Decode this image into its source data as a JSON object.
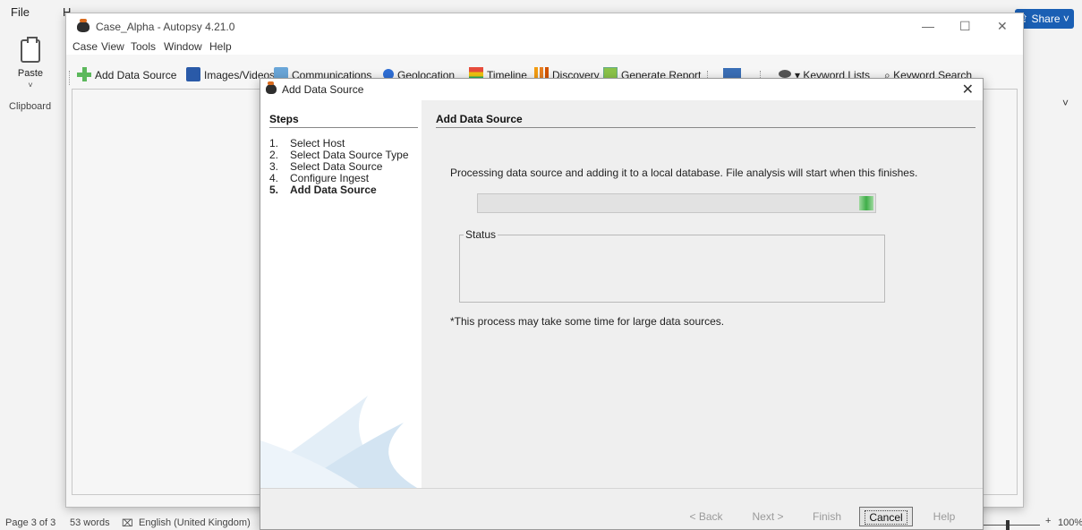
{
  "word": {
    "file_tab": "File",
    "second_tab": "H",
    "paste_label": "Paste",
    "clipboard_label": "Clipboard",
    "share_label": "⇪ Share ˅",
    "status": {
      "page": "Page 3 of 3",
      "words": "53 words",
      "language": "English (United Kingdom)",
      "zoom_plus": "+",
      "zoom": "100%"
    }
  },
  "autopsy": {
    "title": "Case_Alpha - Autopsy 4.21.0",
    "menu": [
      "Case",
      "View",
      "Tools",
      "Window",
      "Help"
    ],
    "toolbar": {
      "add_data_source": "Add Data Source",
      "images_videos": "Images/Videos",
      "communications": "Communications",
      "geolocation": "Geolocation",
      "timeline": "Timeline",
      "discovery": "Discovery",
      "generate_report": "Generate Report",
      "keyword_lists": "▾ Keyword Lists",
      "keyword_search": "Keyword Search"
    }
  },
  "dialog": {
    "title": "Add Data Source",
    "steps_heading": "Steps",
    "steps": [
      {
        "num": "1.",
        "label": "Select Host"
      },
      {
        "num": "2.",
        "label": "Select Data Source Type"
      },
      {
        "num": "3.",
        "label": "Select Data Source"
      },
      {
        "num": "4.",
        "label": "Configure Ingest"
      },
      {
        "num": "5.",
        "label": "Add Data Source"
      }
    ],
    "current_step": 5,
    "panel_heading": "Add Data Source",
    "processing_text": "Processing data source and adding it to a local database. File analysis will start when this finishes.",
    "status_label": "Status",
    "note": "*This process may take some time for large data sources.",
    "buttons": {
      "back": "< Back",
      "next": "Next >",
      "finish": "Finish",
      "cancel": "Cancel",
      "help": "Help"
    }
  },
  "colors": {
    "progress_fill": "#3fae49",
    "share_button": "#1a5fb4"
  }
}
